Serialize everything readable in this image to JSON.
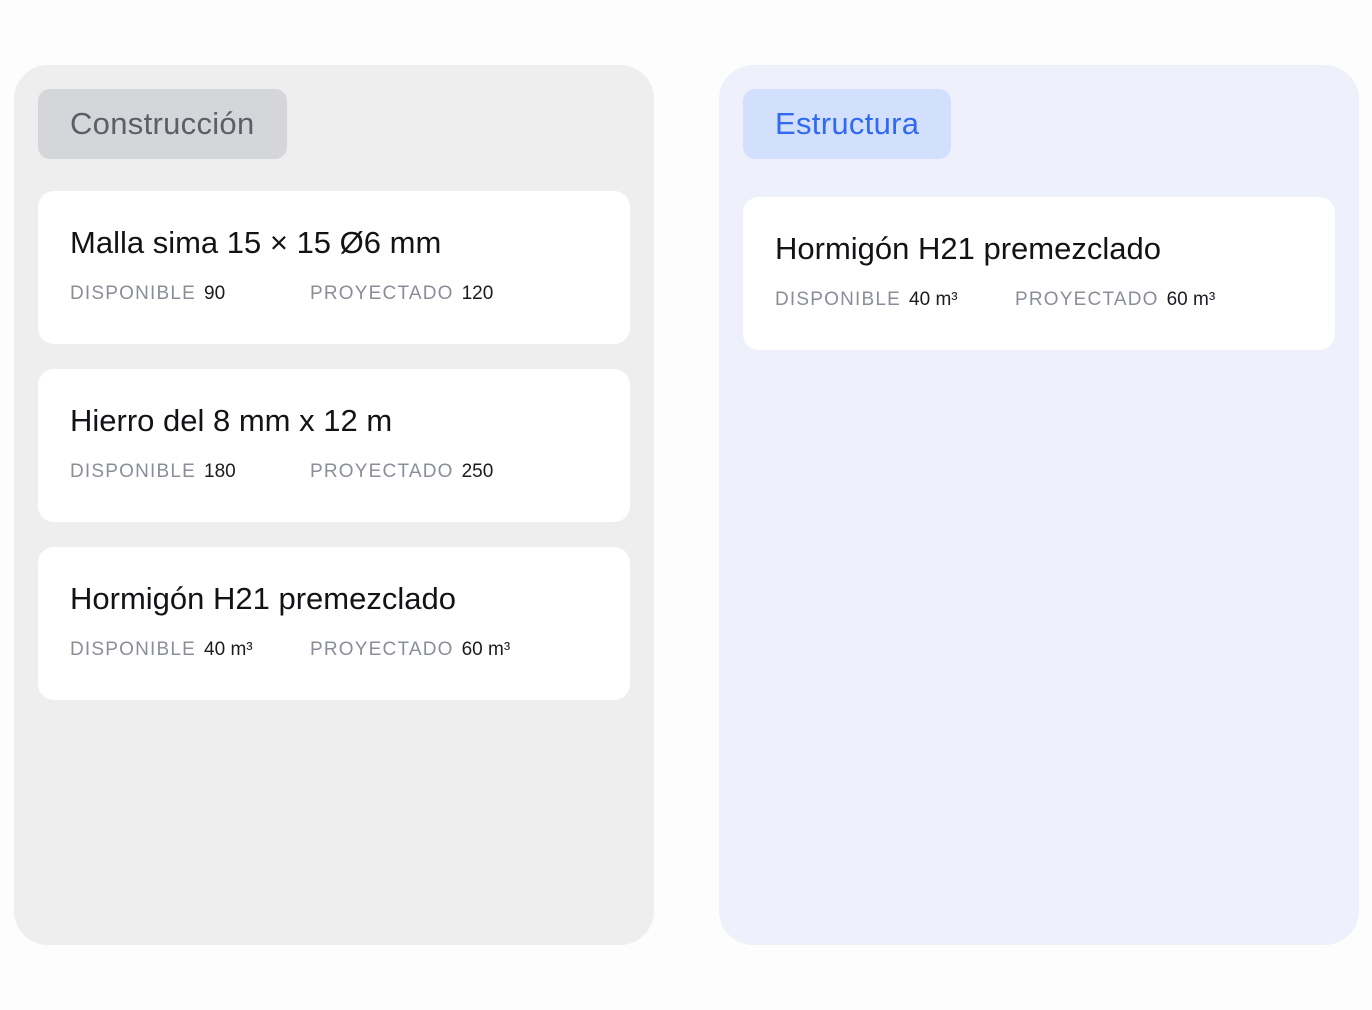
{
  "columns": [
    {
      "tag": "Construcción",
      "cards": [
        {
          "title": "Malla sima 15 × 15 Ø6 mm",
          "available_label": "DISPONIBLE",
          "available": "90",
          "projected_label": "PROYECTADO",
          "projected": "120"
        },
        {
          "title": "Hierro del 8 mm x 12 m",
          "available_label": "DISPONIBLE",
          "available": "180",
          "projected_label": "PROYECTADO",
          "projected": "250"
        },
        {
          "title": "Hormigón H21 premezclado",
          "available_label": "DISPONIBLE",
          "available": "40 m³",
          "projected_label": "PROYECTADO",
          "projected": "60 m³"
        }
      ]
    },
    {
      "tag": "Estructura",
      "cards": [
        {
          "title": "Hormigón H21 premezclado",
          "available_label": "DISPONIBLE",
          "available": "40 m³",
          "projected_label": "PROYECTADO",
          "projected": "60 m³"
        }
      ]
    }
  ],
  "colors": {
    "left_column_bg": "#eeeeee",
    "right_column_bg": "#eef1fc",
    "left_tag_bg": "#d5d6da",
    "right_tag_bg": "#d2e0fe",
    "right_tag_text": "#2f6af0"
  }
}
